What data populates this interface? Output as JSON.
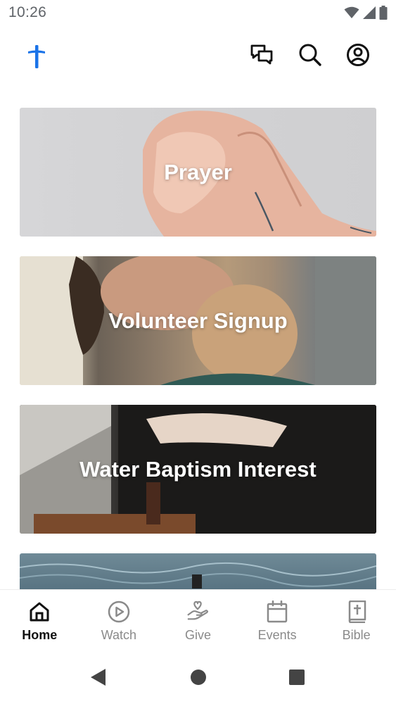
{
  "status_bar": {
    "time": "10:26",
    "icons": [
      "wifi-icon",
      "cellular-signal-icon",
      "battery-icon"
    ]
  },
  "header": {
    "logo": "cross-logo",
    "actions": [
      {
        "name": "chat-icon"
      },
      {
        "name": "search-icon"
      },
      {
        "name": "profile-icon"
      }
    ]
  },
  "feed": {
    "cards": [
      {
        "title": "Prayer"
      },
      {
        "title": "Volunteer Signup"
      },
      {
        "title": "Water Baptism Interest"
      },
      {
        "title": ""
      }
    ]
  },
  "bottom_nav": {
    "items": [
      {
        "label": "Home",
        "icon": "home-icon",
        "active": true
      },
      {
        "label": "Watch",
        "icon": "play-circle-icon",
        "active": false
      },
      {
        "label": "Give",
        "icon": "give-hand-heart-icon",
        "active": false
      },
      {
        "label": "Events",
        "icon": "calendar-icon",
        "active": false
      },
      {
        "label": "Bible",
        "icon": "bible-icon",
        "active": false
      }
    ]
  },
  "system_nav": {
    "buttons": [
      "back-icon",
      "home-circle-icon",
      "recents-square-icon"
    ]
  },
  "colors": {
    "brand": "#1a73e8",
    "active_nav": "#111111",
    "inactive_nav": "#8a8a8a",
    "status_gray": "#5f6368"
  }
}
